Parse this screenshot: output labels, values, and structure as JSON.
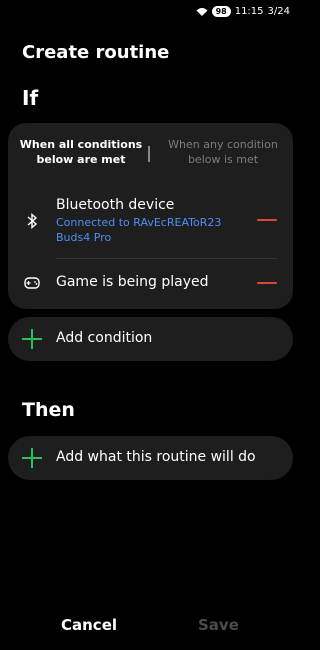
{
  "status_bar": {
    "battery": "98",
    "time": "11:15",
    "date": "3/24"
  },
  "header": {
    "title": "Create routine"
  },
  "if_section": {
    "heading": "If",
    "mode_all": "When all conditions\nbelow are met",
    "mode_any": "When any condition\nbelow is met",
    "conditions": [
      {
        "icon": "bluetooth-icon",
        "title": "Bluetooth device",
        "detail": "Connected to RAvEcREAToR23\nBuds4 Pro"
      },
      {
        "icon": "gamepad-icon",
        "title": "Game is being played"
      }
    ],
    "add_condition_label": "Add condition"
  },
  "then_section": {
    "heading": "Then",
    "add_action_label": "Add what this routine will do"
  },
  "footer": {
    "cancel_label": "Cancel",
    "save_label": "Save"
  },
  "colors": {
    "accent_blue": "#4f8ff5",
    "remove_red": "#e0453c",
    "add_green": "#2bbf5e",
    "card_bg": "#1e1e1e"
  }
}
